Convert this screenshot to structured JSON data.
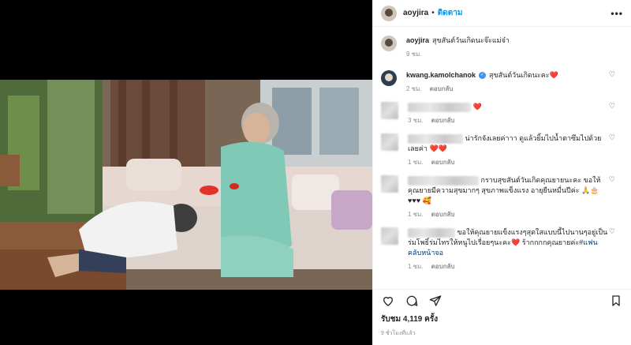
{
  "post": {
    "username": "aoyjira",
    "follow_label": "ติดตาม",
    "more_label": "•••",
    "caption_user": "aoyjira",
    "caption_text": "สุขสันต์วันเกิดนะจ๊ะแม่จ๋า",
    "caption_time": "9 ชม."
  },
  "comments": [
    {
      "user": "kwang.kamolchanok",
      "verified": true,
      "text": "สุขสันต์วันเกิดนะคะ",
      "emoji": "❤️",
      "time": "2 ชม.",
      "reply": "ตอบกลับ"
    },
    {
      "user": "",
      "text": "",
      "emoji": "❤️",
      "time": "3 ชม.",
      "reply": "ตอบกลับ"
    },
    {
      "user": "",
      "text": "น่ารักจังเลยค่าาา ดูแล้วยิ้มไปน้ำตาซึมไปด้วยเลยค่า",
      "emoji": "❤️❤️",
      "time": "1 ชม.",
      "reply": "ตอบกลับ"
    },
    {
      "user": "",
      "text": "กราบสุขสันต์วันเกิดคุณยายนะคะ ขอให้คุณยายมีความสุขมากๆ สุขภาพแข็งแรง อายุยืนหมื่นปีค่ะ",
      "emoji": "🙏🎂♥♥♥ 🥰",
      "time": "1 ชม.",
      "reply": "ตอบกลับ"
    },
    {
      "user": "",
      "text": "ขอให้คุณยายแข็งแรงๆสุดใสแบบนี้ไปนานๆอยู่เป็นร่มโพธิ์ร่มไทรให้หนูไปเรื่อยๆนะคะ",
      "emoji": "❤️",
      "text2": "ร้ากกกกคุณยายค่ะ",
      "hashtag": "#แฟนคลับหน้าจอ",
      "time": "1 ชม.",
      "reply": "ตอบกลับ"
    }
  ],
  "views_label": "รับชม 4,119 ครั้ง",
  "time_ago": "9 ชั่วโมงที่แล้ว",
  "icons": {
    "like": "heart-icon",
    "comment": "comment-icon",
    "share": "paper-plane-icon",
    "save": "bookmark-icon"
  }
}
